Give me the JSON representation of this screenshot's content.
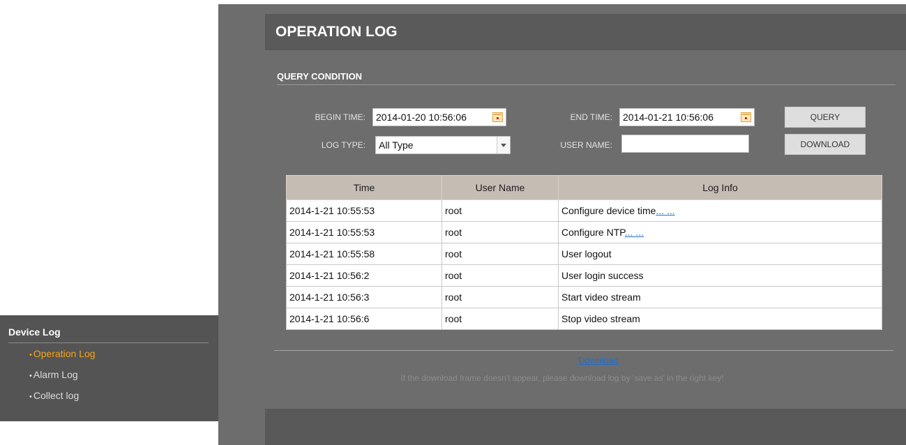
{
  "sidebar": {
    "title": "Device Log",
    "items": [
      {
        "label": "Operation Log",
        "active": true
      },
      {
        "label": "Alarm Log",
        "active": false
      },
      {
        "label": "Collect log",
        "active": false
      }
    ],
    "bullet": "•"
  },
  "page": {
    "title": "OPERATION LOG",
    "query_header": "QUERY CONDITION"
  },
  "query": {
    "begin_label": "BEGIN TIME:",
    "begin_value": "2014-01-20 10:56:06",
    "end_label": "END TIME:",
    "end_value": "2014-01-21 10:56:06",
    "logtype_label": "LOG TYPE:",
    "logtype_value": "All Type",
    "username_label": "USER NAME:",
    "username_value": "",
    "query_button": "QUERY",
    "download_button": "DOWNLOAD"
  },
  "table": {
    "columns": [
      "Time",
      "User Name",
      "Log Info"
    ],
    "rows": [
      {
        "time": "2014-1-21 10:55:53",
        "user": "root",
        "info": "Configure device time",
        "more": "... ..."
      },
      {
        "time": "2014-1-21 10:55:53",
        "user": "root",
        "info": "Configure NTP",
        "more": "... ..."
      },
      {
        "time": "2014-1-21 10:55:58",
        "user": "root",
        "info": "User logout",
        "more": ""
      },
      {
        "time": "2014-1-21 10:56:2",
        "user": "root",
        "info": "User login success",
        "more": ""
      },
      {
        "time": "2014-1-21 10:56:3",
        "user": "root",
        "info": "Start video stream",
        "more": ""
      },
      {
        "time": "2014-1-21 10:56:6",
        "user": "root",
        "info": "Stop video stream",
        "more": ""
      }
    ]
  },
  "footer": {
    "download_link": "Download",
    "hint": "If the download frame doesn't appear, please download log by 'save as' in the right key!"
  },
  "colors": {
    "sidebar_bg": "#545454",
    "main_bg": "#6d6d6d",
    "active_item": "#f7a21b",
    "link": "#1f6fcf",
    "table_header_bg": "#c5bcb4"
  }
}
